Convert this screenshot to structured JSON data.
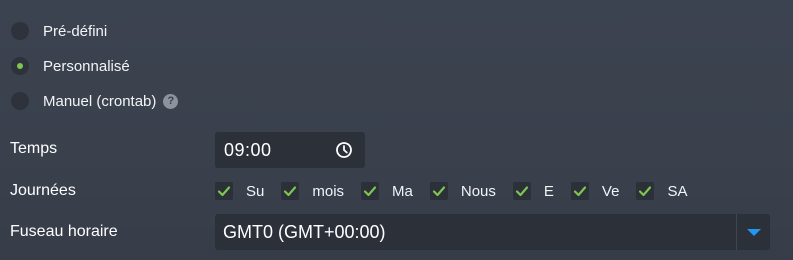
{
  "schedule_type": {
    "options": [
      {
        "label": "Pré-défini",
        "checked": false
      },
      {
        "label": "Personnalisé",
        "checked": true
      },
      {
        "label": "Manuel (crontab)",
        "checked": false,
        "help_icon": "question-icon"
      }
    ]
  },
  "time": {
    "label": "Temps",
    "value": "09:00",
    "icon": "clock-icon"
  },
  "days": {
    "label": "Journées",
    "items": [
      {
        "label": "Su",
        "checked": true
      },
      {
        "label": "mois",
        "checked": true
      },
      {
        "label": "Ma",
        "checked": true
      },
      {
        "label": "Nous",
        "checked": true
      },
      {
        "label": "E",
        "checked": true
      },
      {
        "label": "Ve",
        "checked": true
      },
      {
        "label": "SA",
        "checked": true
      }
    ]
  },
  "timezone": {
    "label": "Fuseau horaire",
    "value": "GMT0 (GMT+00:00)",
    "icon": "chevron-down-icon"
  },
  "colors": {
    "check_green": "#7fc650",
    "dropdown_arrow_blue": "#2196f3"
  }
}
